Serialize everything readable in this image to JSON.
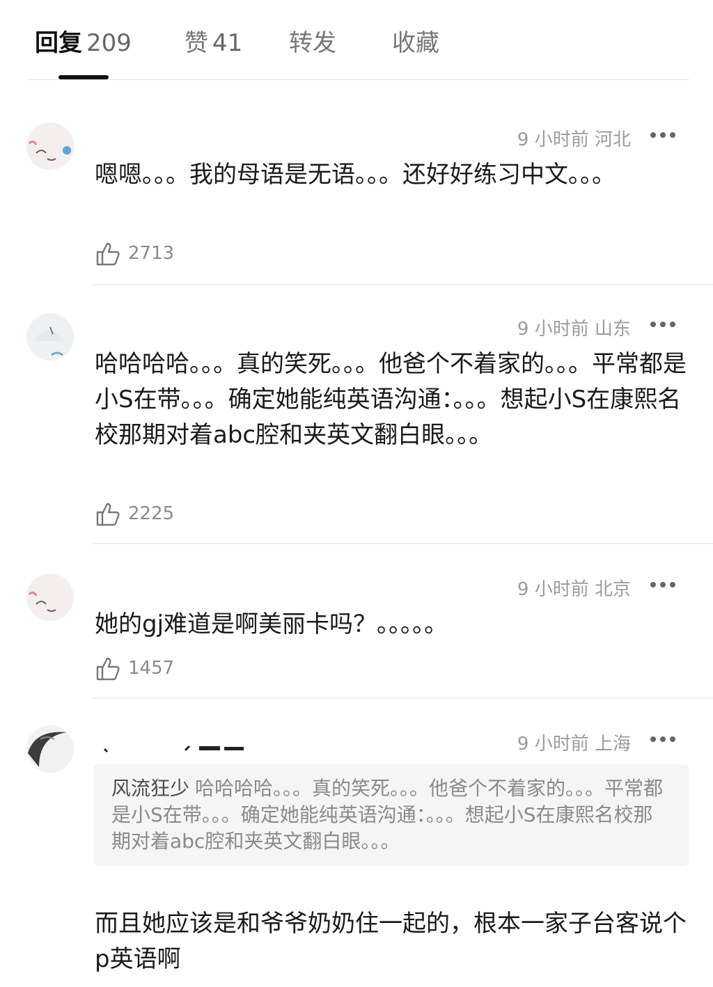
{
  "tabs": [
    {
      "label": "回复",
      "count": "209"
    },
    {
      "label": "赞",
      "count": "41"
    },
    {
      "label": "转发",
      "count": ""
    },
    {
      "label": "收藏",
      "count": ""
    }
  ],
  "comments": [
    {
      "meta": "9 小时前 河北",
      "content": "嗯嗯。。。我的母语是无语。。。还好好练习中文。。。",
      "likes": "2713"
    },
    {
      "meta": "9 小时前 山东",
      "content": "哈哈哈哈。。。真的笑死。。。他爸个不着家的。。。平常都是小S在带。。。确定她能纯英语沟通：。。。想起小S在康熙名校那期对着abc腔和夹英文翻白眼。。。",
      "likes": "2225"
    },
    {
      "meta": "9 小时前 北京",
      "content": "她的gj难道是啊美丽卡吗？。。。。。",
      "likes": "1457"
    },
    {
      "meta": "9 小时前 上海",
      "quote_author": "风流狂少",
      "quote_text": "哈哈哈哈。。。真的笑死。。。他爸个不着家的。。。平常都是小S在带。。。确定她能纯英语沟通：。。。想起小S在康熙名校那期对着abc腔和夹英文翻白眼。。。",
      "content": "而且她应该是和爷爷奶奶住一起的，根本一家子台客说个p英语啊"
    }
  ]
}
